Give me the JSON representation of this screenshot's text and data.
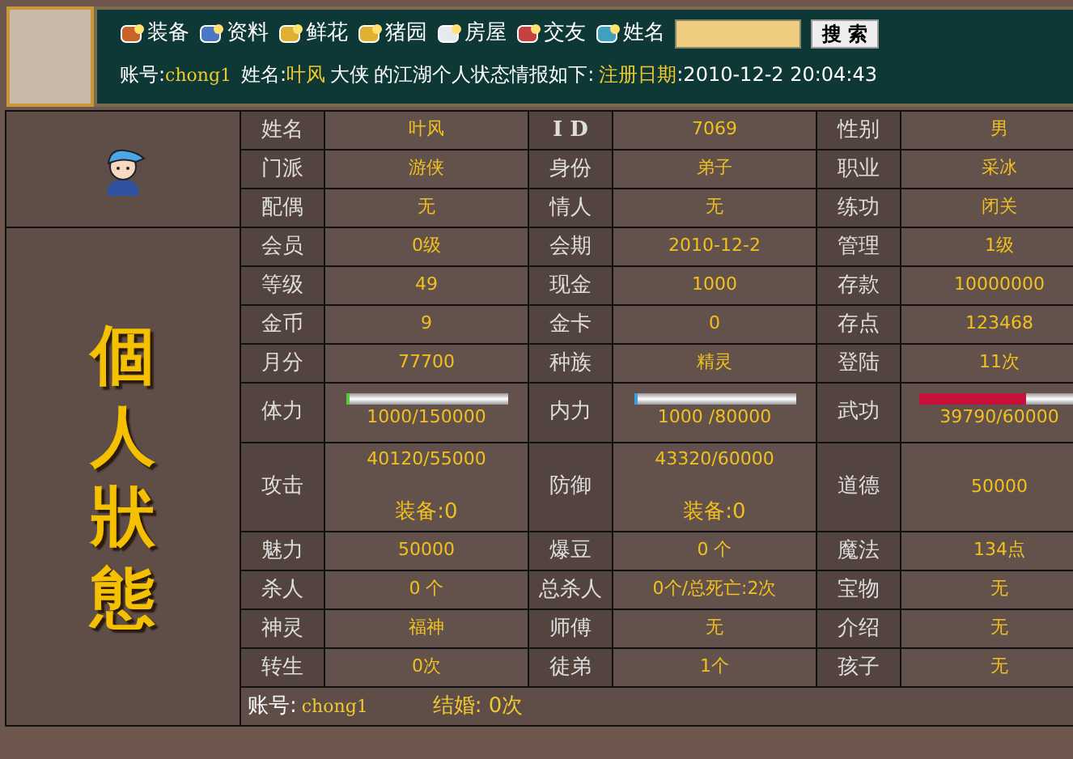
{
  "header": {
    "nav_items": [
      {
        "label": "装备",
        "color": "#c86428"
      },
      {
        "label": "资料",
        "color": "#4a78c8"
      },
      {
        "label": "鲜花",
        "color": "#e0b030"
      },
      {
        "label": "猪园",
        "color": "#e0b030"
      },
      {
        "label": "房屋",
        "color": "#e8e8f0"
      },
      {
        "label": "交友",
        "color": "#c84040"
      },
      {
        "label": "姓名",
        "color": "#40a0c0"
      }
    ],
    "search": {
      "button": "搜 索"
    },
    "info": {
      "account_label": "账号:",
      "account": "chong1",
      "name_label": "姓名:",
      "name": "叶风",
      "rank": "大侠",
      "text": "的江湖个人状态情报如下:",
      "reg_label": "注册日期",
      "reg_value": ":2010-12-2 20:04:43"
    }
  },
  "side": {
    "title": "個人狀態"
  },
  "rows": [
    {
      "cells": [
        {
          "kind": "text",
          "label": "姓名",
          "value": "叶风"
        },
        {
          "kind": "text",
          "label": "I D",
          "value": "7069"
        },
        {
          "kind": "text",
          "label": "性别",
          "value": "男"
        }
      ]
    },
    {
      "cells": [
        {
          "kind": "text",
          "label": "门派",
          "value": "游侠"
        },
        {
          "kind": "text",
          "label": "身份",
          "value": "弟子"
        },
        {
          "kind": "text",
          "label": "职业",
          "value": "采冰"
        }
      ]
    },
    {
      "cells": [
        {
          "kind": "text",
          "label": "配偶",
          "value": "无"
        },
        {
          "kind": "text",
          "label": "情人",
          "value": "无"
        },
        {
          "kind": "text",
          "label": "练功",
          "value": "闭关"
        }
      ]
    },
    {
      "cells": [
        {
          "kind": "text",
          "label": "会员",
          "value": "0级"
        },
        {
          "kind": "text",
          "label": "会期",
          "value": "2010-12-2"
        },
        {
          "kind": "text",
          "label": "管理",
          "value": "1级"
        }
      ]
    },
    {
      "cells": [
        {
          "kind": "text",
          "label": "等级",
          "value": "49"
        },
        {
          "kind": "text",
          "label": "现金",
          "value": "1000"
        },
        {
          "kind": "text",
          "label": "存款",
          "value": "10000000"
        }
      ]
    },
    {
      "cells": [
        {
          "kind": "text",
          "label": "金币",
          "value": "9"
        },
        {
          "kind": "text",
          "label": "金卡",
          "value": "0"
        },
        {
          "kind": "text",
          "label": "存点",
          "value": "123468"
        }
      ]
    },
    {
      "cells": [
        {
          "kind": "text",
          "label": "月分",
          "value": "77700"
        },
        {
          "kind": "text",
          "label": "种族",
          "value": "精灵"
        },
        {
          "kind": "text",
          "label": "登陆",
          "value": "11次"
        }
      ]
    },
    {
      "cells": [
        {
          "kind": "bar",
          "label": "体力",
          "level": 0.02,
          "color": "#5cc83c",
          "reading": "1000/150000"
        },
        {
          "kind": "bar",
          "label": "内力",
          "level": 0.02,
          "color": "#3ca0e0",
          "reading": "1000 /80000"
        },
        {
          "kind": "bar",
          "label": "武功",
          "level": 0.66,
          "color": "#c8103c",
          "reading": "39790/60000"
        }
      ]
    },
    {
      "cells": [
        {
          "kind": "split",
          "label": "攻击",
          "value": "40120/55000",
          "sub": "装备:0"
        },
        {
          "kind": "split",
          "label": "防御",
          "value": "43320/60000",
          "sub": "装备:0"
        },
        {
          "kind": "text",
          "label": "道德",
          "value": "50000"
        }
      ]
    },
    {
      "cells": [
        {
          "kind": "text",
          "label": "魅力",
          "value": "50000"
        },
        {
          "kind": "text",
          "label": "爆豆",
          "value": "0 个"
        },
        {
          "kind": "text",
          "label": "魔法",
          "value": "134点"
        }
      ]
    },
    {
      "cells": [
        {
          "kind": "text",
          "label": "杀人",
          "value": "0 个"
        },
        {
          "kind": "text",
          "label": "总杀人",
          "value": "0个/总死亡:2次"
        },
        {
          "kind": "text",
          "label": "宝物",
          "value": "无"
        }
      ]
    },
    {
      "cells": [
        {
          "kind": "text",
          "label": "神灵",
          "value": "福神"
        },
        {
          "kind": "text",
          "label": "师傅",
          "value": "无"
        },
        {
          "kind": "text",
          "label": "介绍",
          "value": "无"
        }
      ]
    },
    {
      "cells": [
        {
          "kind": "text",
          "label": "转生",
          "value": "0次"
        },
        {
          "kind": "text",
          "label": "徒弟",
          "value": "1个"
        },
        {
          "kind": "text",
          "label": "孩子",
          "value": "无"
        }
      ]
    }
  ],
  "footer": {
    "account_label": "账号:",
    "account": "chong1",
    "marriage": "结婚: 0次"
  }
}
